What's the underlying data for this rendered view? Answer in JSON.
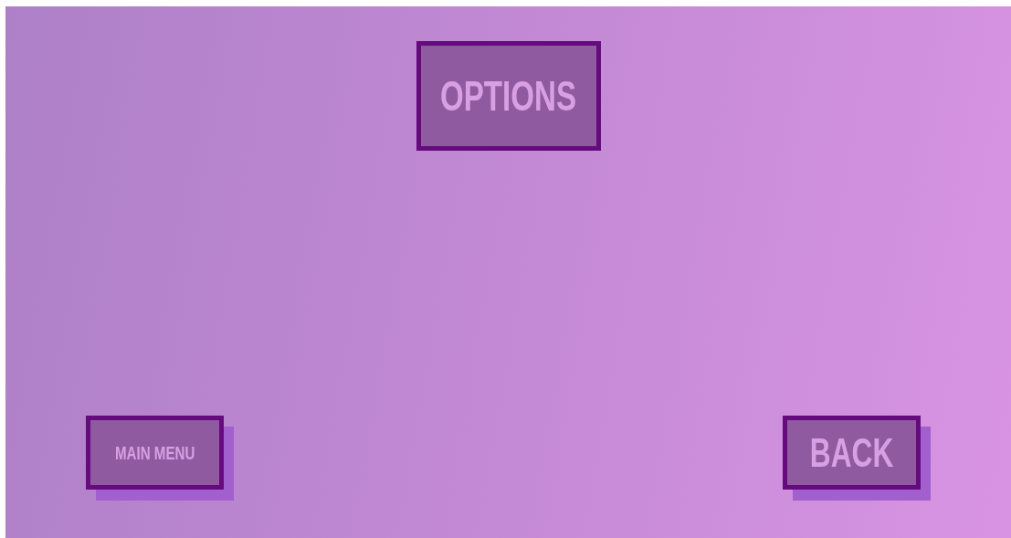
{
  "title": "OPTIONS",
  "buttons": [
    {
      "label": "MAIN MENU"
    },
    {
      "label": "BACK"
    }
  ]
}
